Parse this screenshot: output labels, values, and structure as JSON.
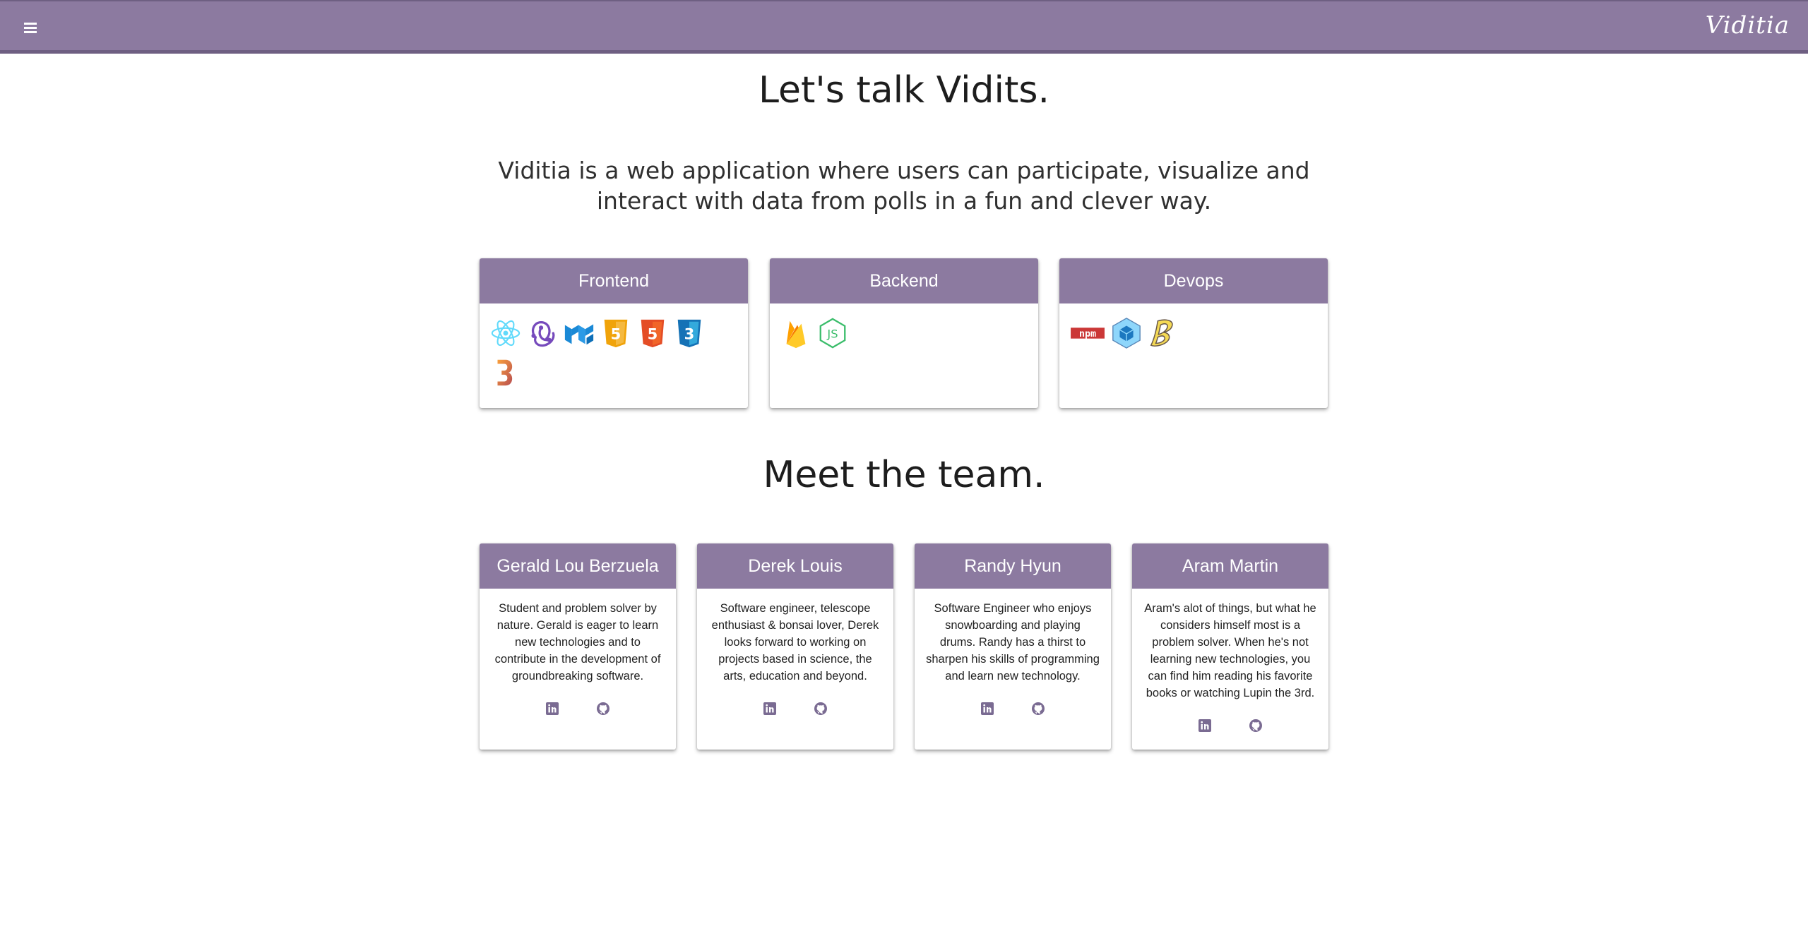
{
  "app": {
    "brand": "Viditia",
    "menu_icon": "hamburger-menu-icon",
    "accent_color": "#8c7aa0"
  },
  "about": {
    "heading": "Let's talk Vidits.",
    "description": "Viditia is a web application where users can participate, visualize and interact with data from polls in a fun and clever way."
  },
  "stack": [
    {
      "title": "Frontend",
      "icons": [
        "react-icon",
        "redux-icon",
        "material-ui-icon",
        "javascript-icon",
        "html5-icon",
        "css3-icon",
        "d3-icon"
      ]
    },
    {
      "title": "Backend",
      "icons": [
        "firebase-icon",
        "nodejs-icon"
      ]
    },
    {
      "title": "Devops",
      "icons": [
        "npm-icon",
        "webpack-icon",
        "babel-icon"
      ]
    }
  ],
  "team": {
    "heading": "Meet the team.",
    "members": [
      {
        "name": "Gerald Lou Berzuela",
        "bio": "Student and problem solver by nature. Gerald is eager to learn new technologies and to contribute in the development of groundbreaking software.",
        "links": [
          "linkedin-icon",
          "github-icon"
        ]
      },
      {
        "name": "Derek Louis",
        "bio": "Software engineer, telescope enthusiast & bonsai lover, Derek looks forward to working on projects based in science, the arts, education and beyond.",
        "links": [
          "linkedin-icon",
          "github-icon"
        ]
      },
      {
        "name": "Randy Hyun",
        "bio": "Software Engineer who enjoys snowboarding and playing drums. Randy has a thirst to sharpen his skills of programming and learn new technology.",
        "links": [
          "linkedin-icon",
          "github-icon"
        ]
      },
      {
        "name": "Aram Martin",
        "bio": "Aram's alot of things, but what he considers himself most is a problem solver. When he's not learning new technologies, you can find him reading his favorite books or watching Lupin the 3rd.",
        "links": [
          "linkedin-icon",
          "github-icon"
        ]
      }
    ]
  }
}
